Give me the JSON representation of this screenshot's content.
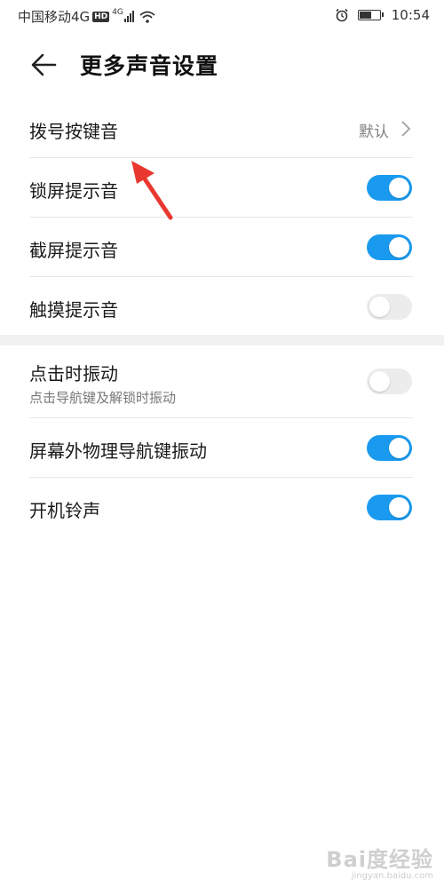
{
  "status_bar": {
    "carrier": "中国移动4G",
    "hd_badge": "HD",
    "network_type": "4G",
    "time": "10:54"
  },
  "header": {
    "title": "更多声音设置"
  },
  "settings": {
    "dial_tone": {
      "label": "拨号按键音",
      "value": "默认"
    },
    "lock_screen_sound": {
      "label": "锁屏提示音",
      "on": true
    },
    "screenshot_sound": {
      "label": "截屏提示音",
      "on": true
    },
    "touch_sound": {
      "label": "触摸提示音",
      "on": false
    },
    "vibrate_on_tap": {
      "label": "点击时振动",
      "sublabel": "点击导航键及解锁时振动",
      "on": false
    },
    "nav_key_vibration": {
      "label": "屏幕外物理导航键振动",
      "on": true
    },
    "startup_ringtone": {
      "label": "开机铃声",
      "on": true
    }
  },
  "watermark": {
    "logo": "Bai度经验",
    "url": "jingyan.baidu.com"
  },
  "colors": {
    "toggle_on": "#1a9aef",
    "toggle_off": "#ececec",
    "annotation_arrow": "#e8382f"
  }
}
